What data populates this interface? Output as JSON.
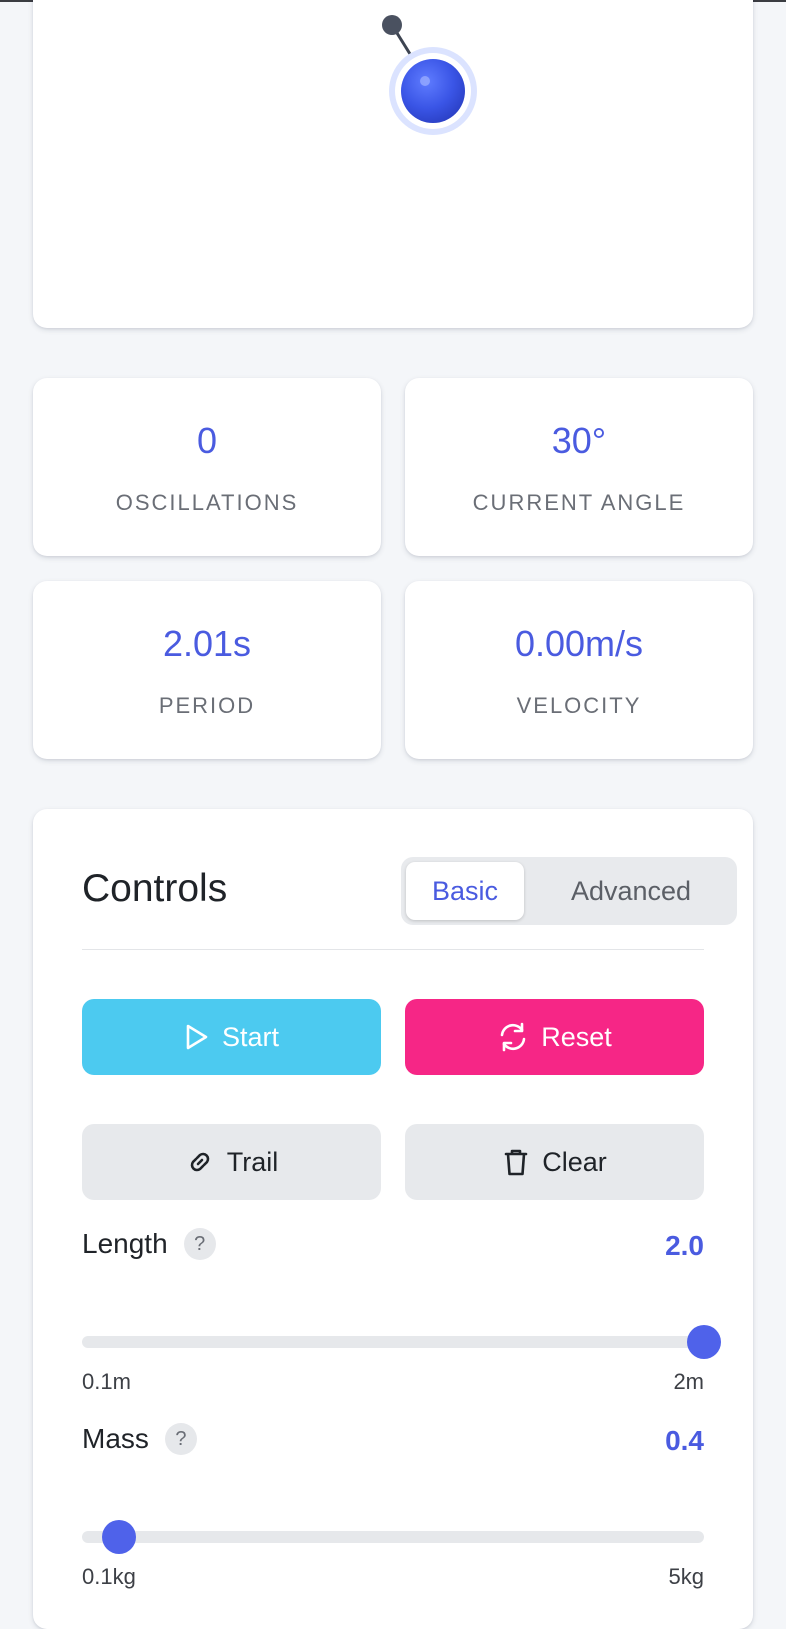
{
  "stats": {
    "oscillations": {
      "value": "0",
      "label": "OSCILLATIONS"
    },
    "angle": {
      "value": "30°",
      "label": "CURRENT ANGLE"
    },
    "period": {
      "value": "2.01s",
      "label": "PERIOD"
    },
    "velocity": {
      "value": "0.00m/s",
      "label": "VELOCITY"
    }
  },
  "controls": {
    "title": "Controls",
    "tabs": {
      "basic": "Basic",
      "advanced": "Advanced",
      "active": "Basic"
    },
    "buttons": {
      "start": "Start",
      "reset": "Reset",
      "trail": "Trail",
      "clear": "Clear"
    },
    "params": {
      "length": {
        "label": "Length",
        "help": "?",
        "value": "2.0",
        "min": "0.1m",
        "max": "2m",
        "fraction": 1.0
      },
      "mass": {
        "label": "Mass",
        "help": "?",
        "value": "0.4",
        "min": "0.1kg",
        "max": "5kg",
        "fraction": 0.06
      }
    }
  },
  "colors": {
    "accent": "#4a5be0",
    "start": "#4ccaf0",
    "reset": "#f62686",
    "bob": "#3a55e6"
  },
  "icons": [
    "play-icon",
    "refresh-icon",
    "link-icon",
    "trash-icon",
    "help-icon"
  ]
}
